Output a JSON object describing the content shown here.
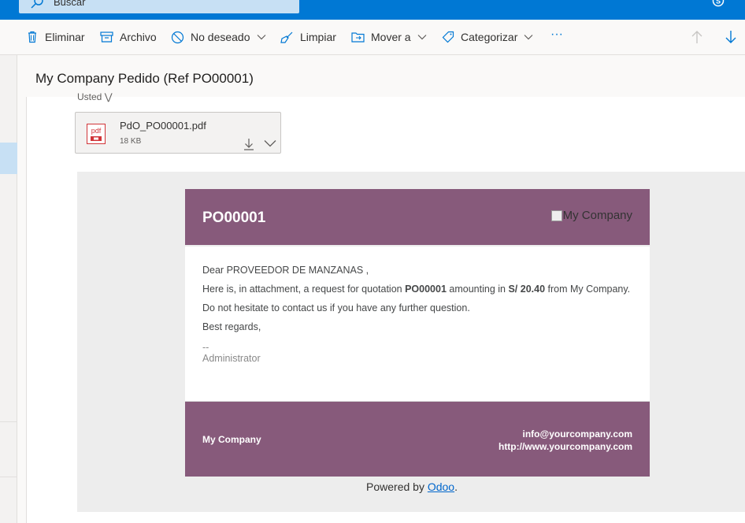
{
  "search": {
    "placeholder": "Buscar"
  },
  "toolbar": {
    "delete_label": "Eliminar",
    "archive_label": "Archivo",
    "junk_label": "No deseado",
    "sweep_label": "Limpiar",
    "move_label": "Mover a",
    "categorize_label": "Categorizar",
    "more_label": "···"
  },
  "message": {
    "subject": "My Company Pedido (Ref PO00001)",
    "to_label": "Usted",
    "attachment": {
      "name": "PdO_PO00001.pdf",
      "size": "18 KB",
      "icon_text": "pdf"
    }
  },
  "email": {
    "po_number": "PO00001",
    "logo_alt": "My Company",
    "greeting": "Dear PROVEEDOR DE MANZANAS ,",
    "line1_pre": "Here is, in attachment, a request for quotation ",
    "line1_ref": "PO00001",
    "line1_mid": " amounting in ",
    "line1_amount": "S/ 20.40",
    "line1_post": " from My Company.",
    "line2": "Do not hesitate to contact us if you have any further question.",
    "line3": "Best regards,",
    "sig_dash": "--",
    "sig_name": "Administrator",
    "footer_company": "My Company",
    "footer_email": "info@yourcompany.com",
    "footer_web": "http://www.yourcompany.com",
    "powered_pre": "Powered by ",
    "powered_link": "Odoo",
    "powered_post": "."
  },
  "colors": {
    "accent": "#0078d4",
    "odoo_purple": "#875a7b"
  }
}
